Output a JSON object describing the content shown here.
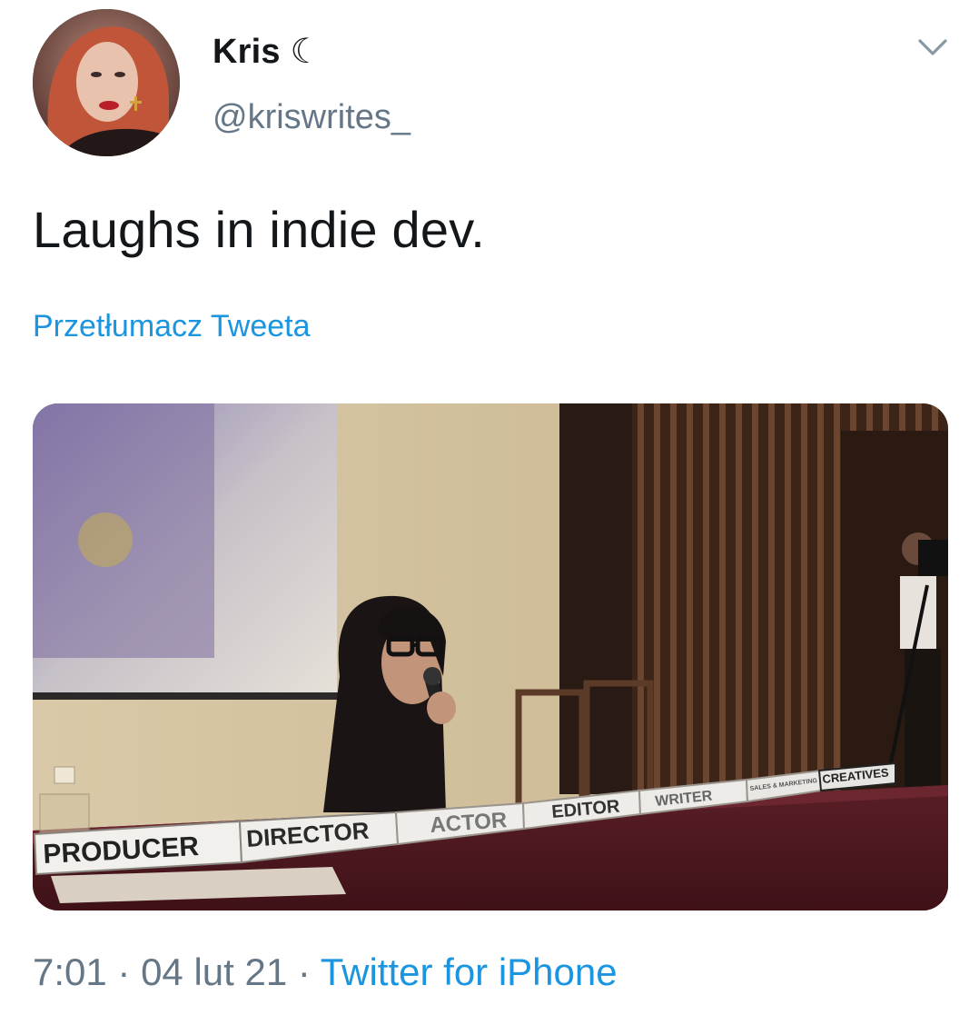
{
  "user": {
    "display_name": "Kris ☾",
    "handle": "@kriswrites_"
  },
  "tweet": {
    "text": "Laughs in indie dev.",
    "translate_label": "Przetłumacz Tweeta"
  },
  "media": {
    "nameplates": [
      "PRODUCER",
      "DIRECTOR",
      "ACTOR",
      "EDITOR",
      "WRITER",
      "SALES & MARKETING",
      "CREATIVES"
    ]
  },
  "meta": {
    "time": "7:01",
    "separator": " · ",
    "date": "04 lut 21",
    "source": "Twitter for iPhone"
  },
  "colors": {
    "link": "#1b95e0",
    "secondary": "#657786",
    "primary": "#14171a"
  }
}
